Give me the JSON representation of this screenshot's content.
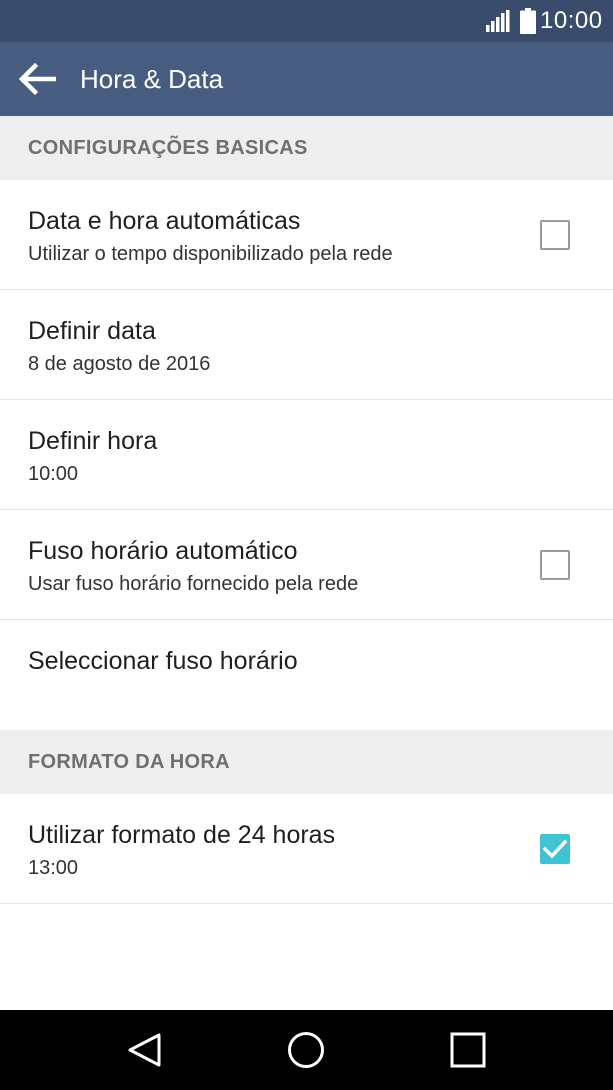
{
  "status_bar": {
    "time": "10:00",
    "signal_icon": "signal-icon",
    "battery_icon": "battery-icon"
  },
  "app_bar": {
    "back_icon": "arrow-back-icon",
    "title": "Hora & Data"
  },
  "sections": [
    {
      "header": "CONFIGURAÇÕES BASICAS",
      "items": [
        {
          "title": "Data e hora automáticas",
          "subtitle": "Utilizar o tempo disponibilizado pela rede",
          "checkbox": false
        },
        {
          "title": "Definir data",
          "subtitle": "8 de agosto de 2016"
        },
        {
          "title": "Definir hora",
          "subtitle": "10:00"
        },
        {
          "title": "Fuso horário automático",
          "subtitle": "Usar fuso horário fornecido pela rede",
          "checkbox": false
        },
        {
          "title": "Seleccionar fuso horário"
        }
      ]
    },
    {
      "header": "FORMATO DA HORA",
      "items": [
        {
          "title": "Utilizar formato de 24 horas",
          "subtitle": "13:00",
          "checkbox": true
        }
      ]
    }
  ],
  "nav_bar": {
    "back_icon": "nav-back-icon",
    "home_icon": "nav-home-icon",
    "recents_icon": "nav-recents-icon"
  },
  "colors": {
    "status_bar": "#3a4c6c",
    "app_bar": "#475d80",
    "checkbox_checked": "#3fc4d6",
    "section_header_bg": "#eeeeee"
  }
}
